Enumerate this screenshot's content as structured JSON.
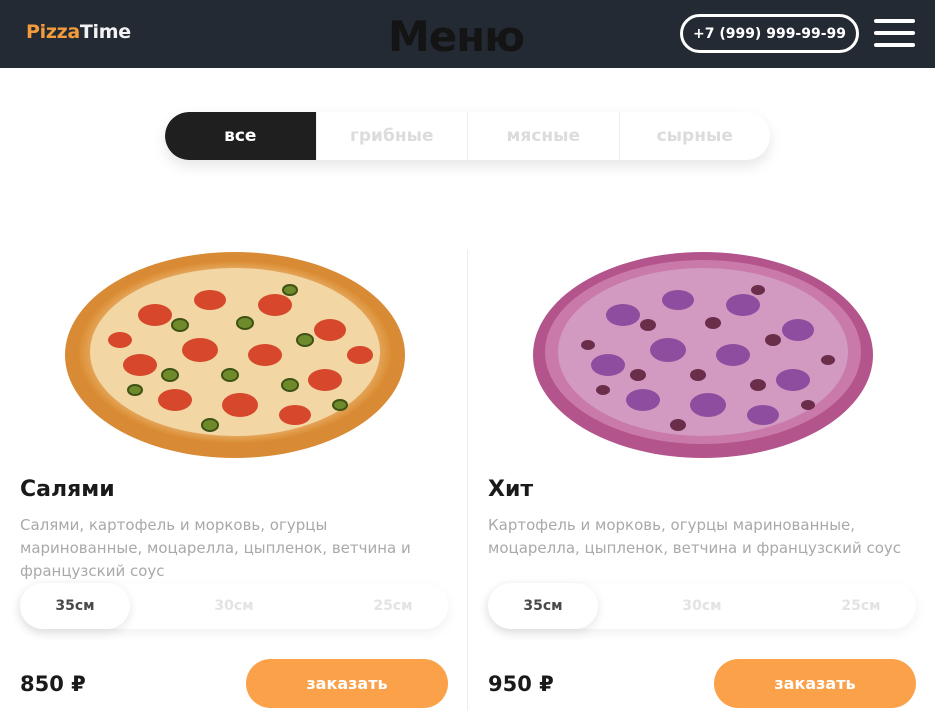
{
  "header": {
    "logo_part1": "Pizza",
    "logo_part2": "Time",
    "title": "Меню",
    "phone": "+7 (999) 999-99-99"
  },
  "filters": [
    {
      "label": "все",
      "active": true
    },
    {
      "label": "грибные",
      "active": false
    },
    {
      "label": "мясные",
      "active": false
    },
    {
      "label": "сырные",
      "active": false
    }
  ],
  "products": [
    {
      "name": "Салями",
      "description": "Салями, картофель и морковь, огурцы маринованные, моцарелла, цыпленок, ветчина и французский соус",
      "sizes": [
        "35см",
        "30см",
        "25см"
      ],
      "selected_size": "35см",
      "price": "850 ₽",
      "order_label": "заказать",
      "image": "pizza-salami"
    },
    {
      "name": "Хит",
      "description": "Картофель и морковь, огурцы маринованные, моцарелла, цыпленок, ветчина и французский соус",
      "sizes": [
        "35см",
        "30см",
        "25см"
      ],
      "selected_size": "35см",
      "price": "950 ₽",
      "order_label": "заказать",
      "image": "pizza-hit"
    }
  ],
  "colors": {
    "header_bg": "#232a33",
    "accent_orange": "#fba14a",
    "logo_orange": "#f39c3b",
    "active_tab": "#1f1f1f"
  }
}
